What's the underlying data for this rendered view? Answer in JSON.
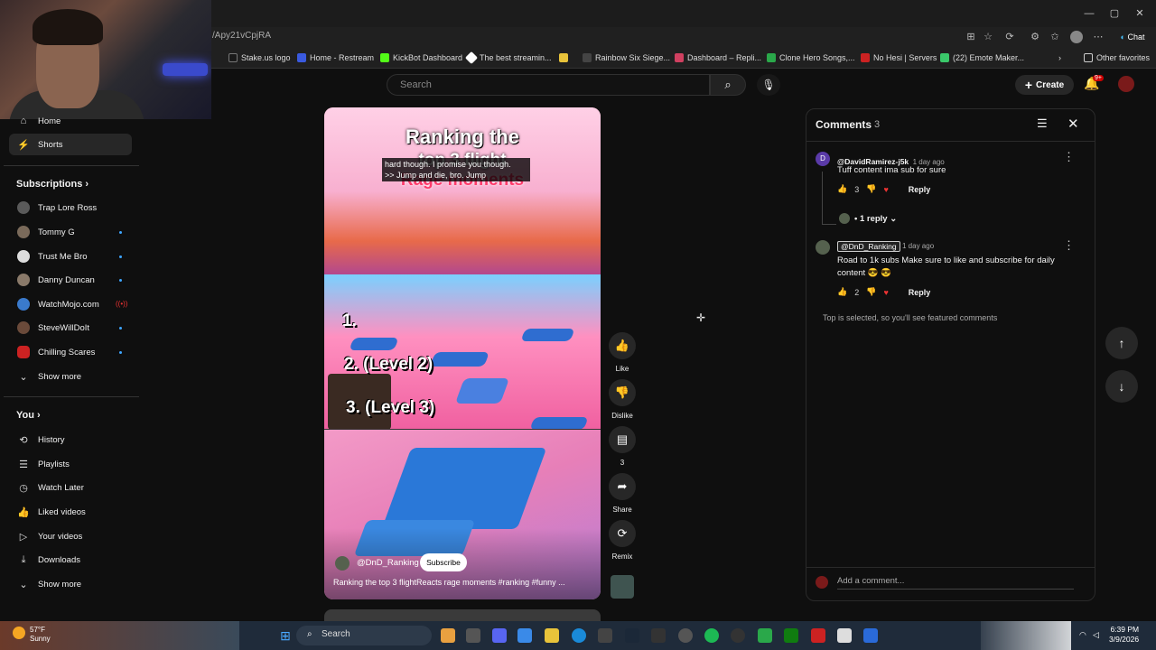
{
  "browser": {
    "url": "/Apy21vCpjRA",
    "window_controls": [
      "—",
      "▢",
      "✕"
    ],
    "chat_label": "Chat",
    "bookmarks": [
      {
        "label": "Stake.us logo",
        "color": "#1a1a1a"
      },
      {
        "label": "Home - Restream",
        "color": "#3a5adf"
      },
      {
        "label": "KickBot Dashboard",
        "color": "#53fc18"
      },
      {
        "label": "The best streamin...",
        "color": "#ffffff"
      },
      {
        "label": "",
        "color": "#e8c33a"
      },
      {
        "label": "Rainbow Six Siege...",
        "color": "#444444"
      },
      {
        "label": "Dashboard – Repli...",
        "color": "#d04060"
      },
      {
        "label": "Clone Hero Songs,...",
        "color": "#2aa84a"
      },
      {
        "label": "No Hesi | Servers",
        "color": "#cc2222"
      },
      {
        "label": "(22) Emote Maker...",
        "color": "#3ac86a"
      }
    ],
    "other_favorites": "Other favorites"
  },
  "header": {
    "search_placeholder": "Search",
    "create_label": "Create",
    "notif_badge": "9+"
  },
  "sidebar": {
    "home": "Home",
    "shorts": "Shorts",
    "subscriptions_title": "Subscriptions",
    "subscriptions": [
      {
        "label": "Trap Lore Ross",
        "color": "#5a5a5a",
        "dot": false
      },
      {
        "label": "Tommy G",
        "color": "#7a6a5a",
        "dot": true
      },
      {
        "label": "Trust Me Bro",
        "color": "#dddddd",
        "dot": true
      },
      {
        "label": "Danny Duncan",
        "color": "#8a7a6a",
        "dot": true
      },
      {
        "label": "WatchMojo.com",
        "color": "#3a7acc",
        "dot": false
      },
      {
        "label": "SteveWillDoIt",
        "color": "#6a4a3a",
        "dot": true
      },
      {
        "label": "Chilling Scares",
        "color": "#cc2222",
        "dot": true
      }
    ],
    "show_more": "Show more",
    "you_title": "You",
    "you_items": [
      "History",
      "Playlists",
      "Watch Later",
      "Liked videos",
      "Your videos",
      "Downloads"
    ],
    "show_more_2": "Show more"
  },
  "short": {
    "title_line1": "Ranking the",
    "title_line2": "top 3 flight",
    "title_line3": "Rage moments",
    "caption_line1": "hard though. I promise you though.",
    "caption_line2": ">> Jump and die, bro. Jump",
    "rank1": "1.",
    "rank2": "2. (Level 2)",
    "rank3": "3. (Level 3)",
    "channel": "@DnD_Ranking",
    "subscribe": "Subscribe",
    "description": "Ranking the top 3 flightReacts rage moments #ranking #funny ..."
  },
  "actions": {
    "like": "Like",
    "dislike": "Dislike",
    "comments_count": "3",
    "share": "Share",
    "remix": "Remix"
  },
  "comments": {
    "title": "Comments",
    "count": "3",
    "items": [
      {
        "author": "@DavidRamirez-j5k",
        "time": "1 day ago",
        "text": "Tuff content ima sub for sure",
        "likes": "3",
        "avatar_letter": "D",
        "avatar_color": "#5a3aa8"
      },
      {
        "author": "@DnD_Ranking",
        "time": "1 day ago",
        "text": "Road to 1k subs Make sure to like and subscribe for daily content 😎 😎",
        "likes": "2",
        "avatar_letter": "",
        "avatar_color": "#55614e"
      }
    ],
    "reply_label": "Reply",
    "replies_toggle": "• 1 reply",
    "note": "Top is selected, so you'll see featured comments",
    "add_placeholder": "Add a comment..."
  },
  "taskbar": {
    "temp": "57°F",
    "condition": "Sunny",
    "search": "Search",
    "time": "6:39 PM",
    "date": "3/9/2026"
  }
}
